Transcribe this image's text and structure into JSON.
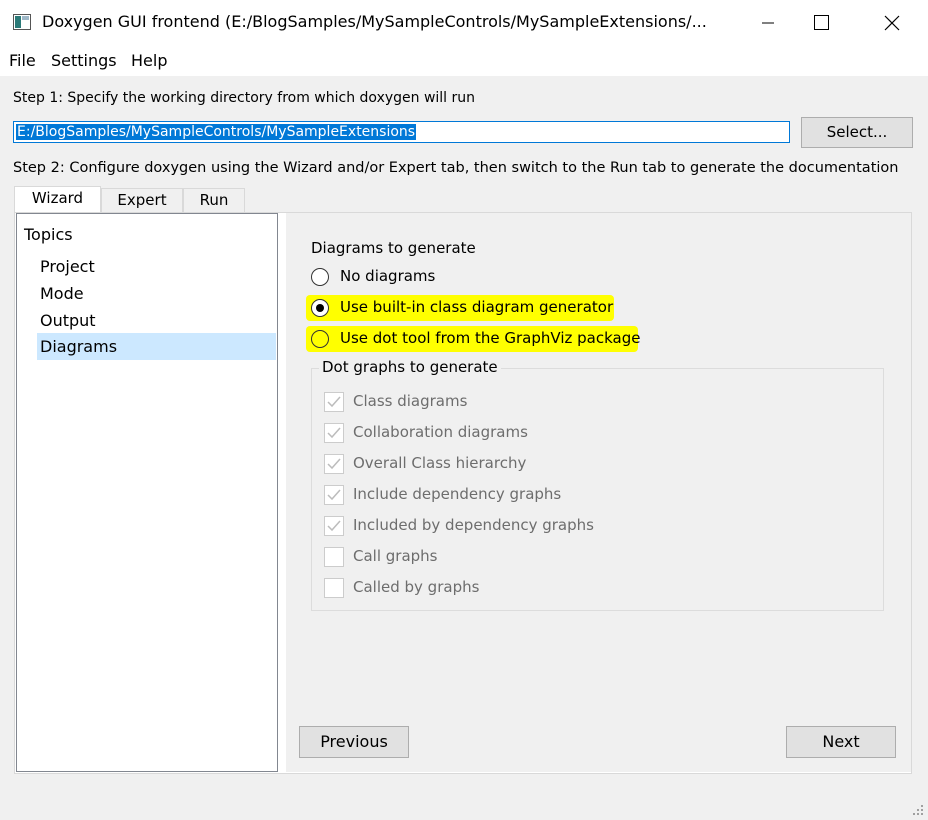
{
  "window": {
    "title": "Doxygen GUI frontend (E:/BlogSamples/MySampleControls/MySampleExtensions/...",
    "icons": [
      "doxygen-app-icon",
      "minimize-icon",
      "maximize-icon",
      "close-icon",
      "resize-grip-icon"
    ]
  },
  "menu": {
    "file": "File",
    "settings": "Settings",
    "help": "Help"
  },
  "step1": {
    "label": "Step 1: Specify the working directory from which doxygen will run",
    "directory_value": "E:/BlogSamples/MySampleControls/MySampleExtensions",
    "select_button": "Select..."
  },
  "step2": {
    "label": "Step 2: Configure doxygen using the Wizard and/or Expert tab, then switch to the Run tab to generate the documentation"
  },
  "tabs": [
    {
      "label": "Wizard",
      "active": true
    },
    {
      "label": "Expert",
      "active": false
    },
    {
      "label": "Run",
      "active": false
    }
  ],
  "topics": {
    "header": "Topics",
    "items": [
      {
        "label": "Project",
        "selected": false
      },
      {
        "label": "Mode",
        "selected": false
      },
      {
        "label": "Output",
        "selected": false
      },
      {
        "label": "Diagrams",
        "selected": true
      }
    ]
  },
  "diagrams": {
    "heading": "Diagrams to generate",
    "options": [
      {
        "label": "No diagrams",
        "checked": false,
        "highlighted": false
      },
      {
        "label": "Use built-in class diagram generator",
        "checked": true,
        "highlighted": true
      },
      {
        "label": "Use dot tool from the GraphViz package",
        "checked": false,
        "highlighted": true
      }
    ],
    "dot_group": {
      "title": "Dot graphs to generate",
      "enabled": false,
      "items": [
        {
          "label": "Class diagrams",
          "checked": true
        },
        {
          "label": "Collaboration diagrams",
          "checked": true
        },
        {
          "label": "Overall Class hierarchy",
          "checked": true
        },
        {
          "label": "Include dependency graphs",
          "checked": true
        },
        {
          "label": "Included by dependency graphs",
          "checked": true
        },
        {
          "label": "Call graphs",
          "checked": false
        },
        {
          "label": "Called by graphs",
          "checked": false
        }
      ]
    }
  },
  "nav": {
    "previous": "Previous",
    "next": "Next"
  },
  "colors": {
    "highlight": "#ffff00",
    "selection": "#0078d7",
    "list_selected": "#cce8ff"
  }
}
